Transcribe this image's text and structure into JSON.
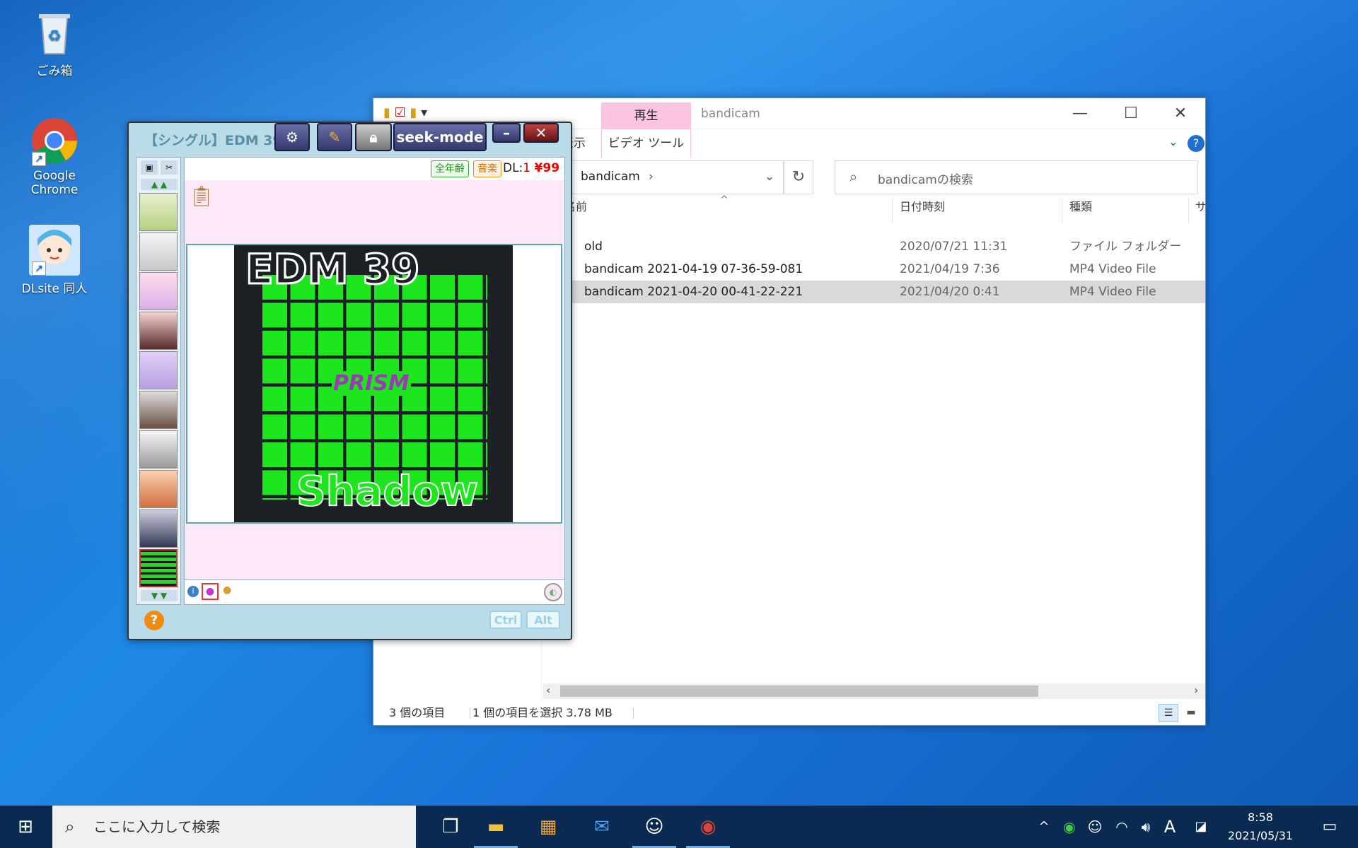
{
  "desktop": {
    "icons": [
      {
        "label": "ごみ箱"
      },
      {
        "label": "Google Chrome"
      },
      {
        "label": "DLsite 同人"
      }
    ]
  },
  "explorer": {
    "ribbon": {
      "play_tab": "再生",
      "video_tools_tab": "ビデオ ツール",
      "view_tab": "表示",
      "folder_title": "bandicam"
    },
    "address": {
      "crumb": "bandicam",
      "search_placeholder": "bandicamの検索"
    },
    "columns": {
      "name": "名前",
      "date": "日付時刻",
      "type": "種類",
      "size": "サ"
    },
    "rows": [
      {
        "name": "old",
        "date": "2020/07/21 11:31",
        "type": "ファイル フォルダー"
      },
      {
        "name": "bandicam 2021-04-19 07-36-59-081",
        "date": "2021/04/19 7:36",
        "type": "MP4 Video File"
      },
      {
        "name": "bandicam 2021-04-20 00-41-22-221",
        "date": "2021/04/20 0:41",
        "type": "MP4 Video File"
      }
    ],
    "status": {
      "count": "3 個の項目",
      "selected": "1 個の項目を選択  3.78 MB"
    }
  },
  "player": {
    "title": "【シングル】EDM 39",
    "seek_label": "seek-mode",
    "tags": {
      "age": "全年齢",
      "genre": "音楽"
    },
    "dl_label": "DL:",
    "dl_count": "1",
    "price": "¥99",
    "cover": {
      "top": "EDM 39",
      "logo": "PRISM",
      "bottom": "Shadow"
    },
    "ctrl": "Ctrl",
    "alt": "Alt",
    "help": "?"
  },
  "taskbar": {
    "search_placeholder": "ここに入力して検索",
    "time": "8:58",
    "date": "2021/05/31",
    "ime": "A"
  }
}
